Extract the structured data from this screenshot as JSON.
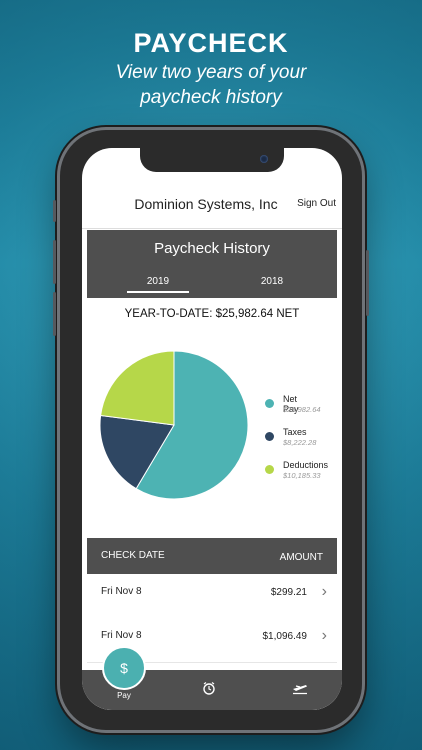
{
  "promo": {
    "headline": "PAYCHECK",
    "subtitle_line1": "View two years of your",
    "subtitle_line2": "paycheck history"
  },
  "header": {
    "company": "Dominion Systems, Inc",
    "sign_out": "Sign Out"
  },
  "paycheck_history": {
    "title": "Paycheck History",
    "tabs": [
      {
        "label": "2019",
        "active": true
      },
      {
        "label": "2018",
        "active": false
      }
    ],
    "ytd": "YEAR-TO-DATE: $25,982.64 NET"
  },
  "chart_data": {
    "type": "pie",
    "slices": [
      {
        "label": "Net Pay",
        "value": 25982.64,
        "display": "$25,982.64",
        "color": "#4db3b3"
      },
      {
        "label": "Taxes",
        "value": 8222.28,
        "display": "$8,222.28",
        "color": "#2f4763"
      },
      {
        "label": "Deductions",
        "value": 10185.33,
        "display": "$10,185.33",
        "color": "#b6d749"
      }
    ]
  },
  "table": {
    "col_date": "CHECK DATE",
    "col_amount": "AMOUNT",
    "rows": [
      {
        "date": "Fri Nov 8",
        "amount": "$299.21"
      },
      {
        "date": "Fri Nov 8",
        "amount": "$1,096.49"
      }
    ]
  },
  "tabbar": {
    "pay_icon": "dollar-icon",
    "pay_symbol": "$",
    "pay_label": "Pay",
    "alarm_icon": "alarm-clock-icon",
    "timeoff_icon": "airplane-icon"
  }
}
